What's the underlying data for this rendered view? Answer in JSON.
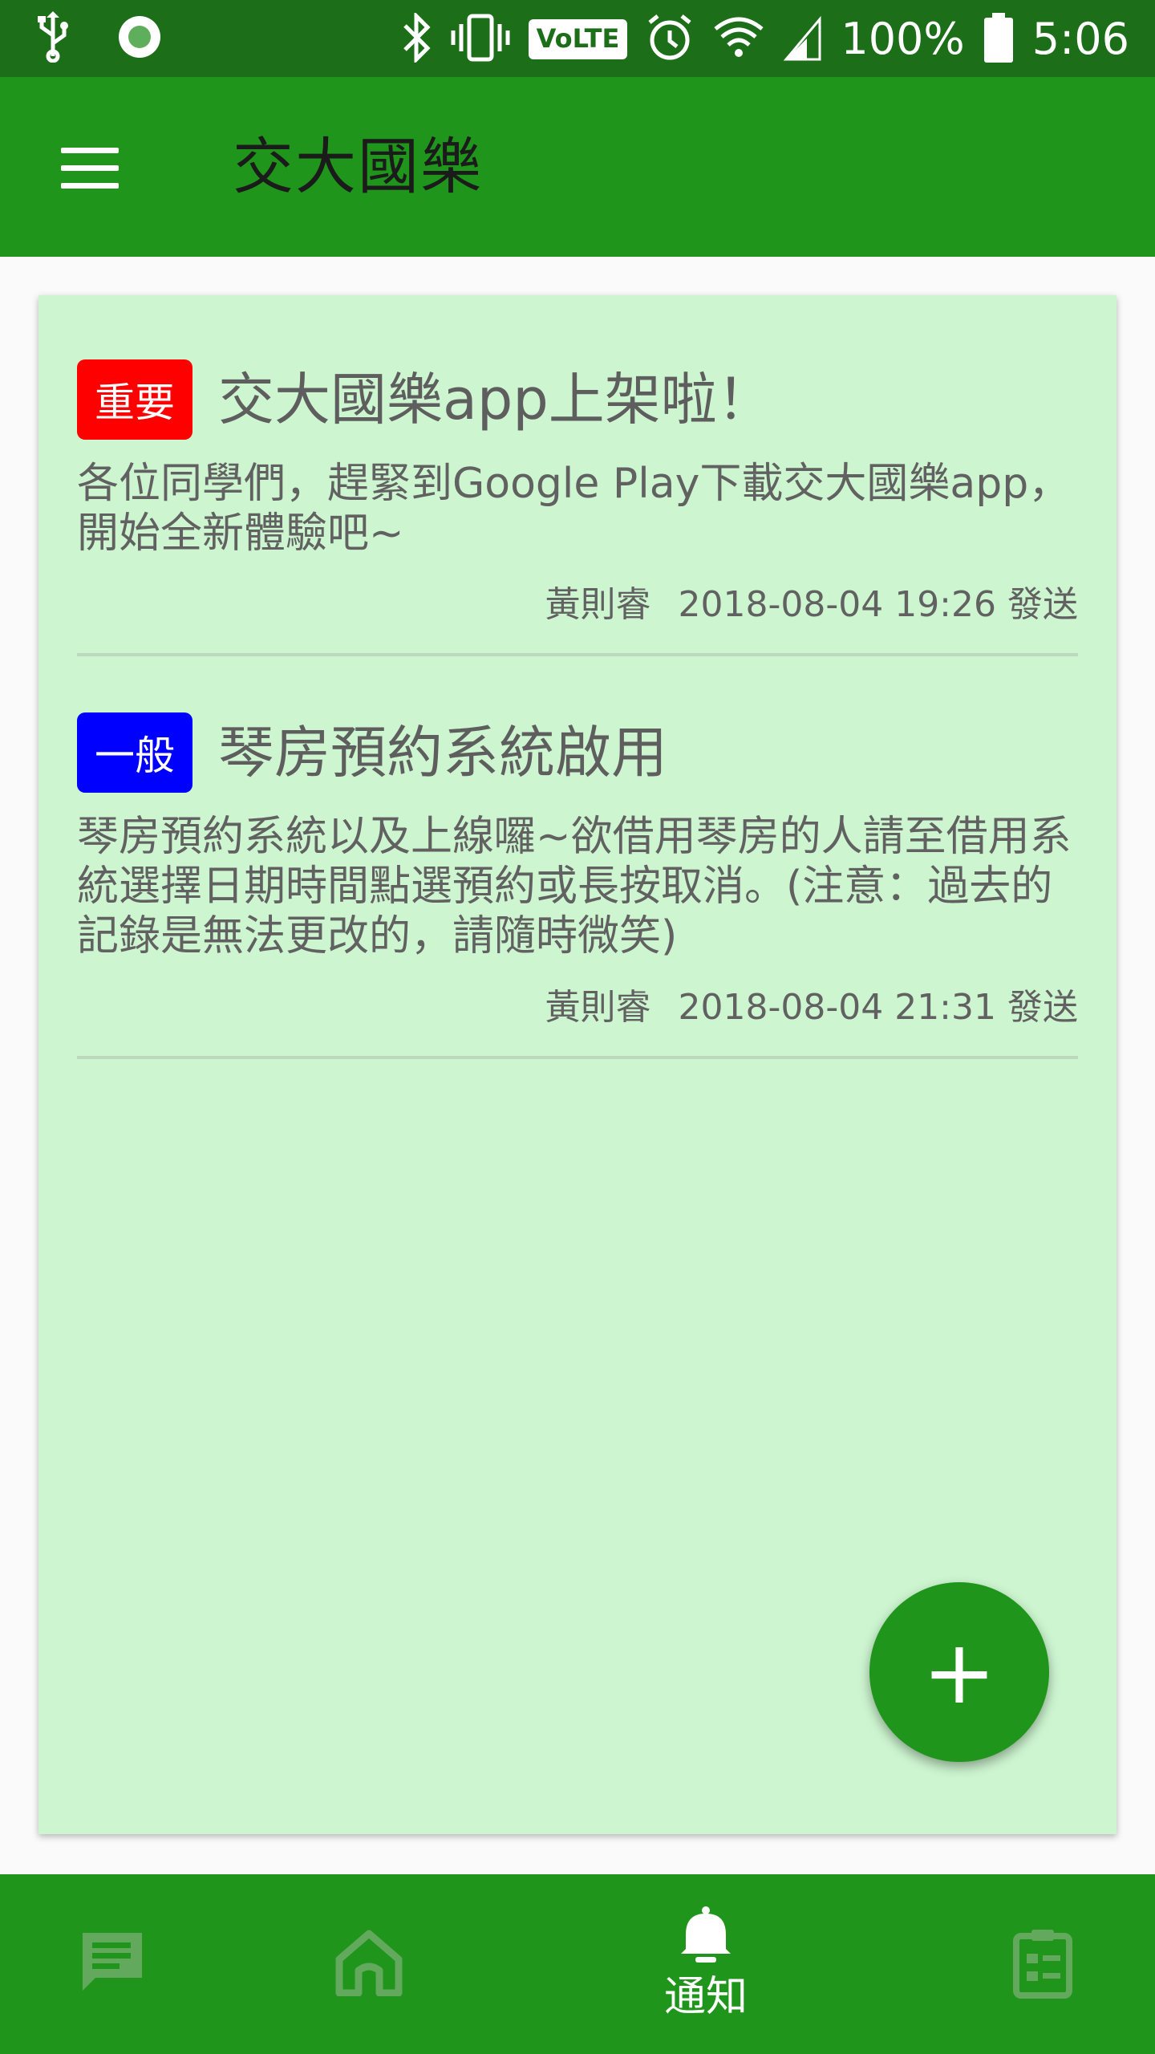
{
  "status_bar": {
    "volte": "VoLTE",
    "battery": "100%",
    "time": "5:06",
    "icons": [
      "usb-icon",
      "record-icon",
      "bluetooth-icon",
      "vibrate-icon",
      "alarm-icon",
      "wifi-icon",
      "signal-icon",
      "battery-icon"
    ]
  },
  "app_bar": {
    "title": "交大國樂",
    "menu_icon": "hamburger-menu-icon"
  },
  "notices": [
    {
      "badge": "重要",
      "badge_color": "#ff0000",
      "title": "交大國樂app上架啦！",
      "body": "各位同學們，趕緊到Google Play下載交大國樂app，開始全新體驗吧~",
      "sender": "黃則睿",
      "datetime": "2018-08-04 19:26",
      "sent_label": "發送"
    },
    {
      "badge": "一般",
      "badge_color": "#0000ff",
      "title": "琴房預約系統啟用",
      "body": "琴房預約系統以及上線囉~欲借用琴房的人請至借用系統選擇日期時間點選預約或長按取消。(注意：過去的記錄是無法更改的，請隨時微笑)",
      "sender": "黃則睿",
      "datetime": "2018-08-04 21:31",
      "sent_label": "發送"
    }
  ],
  "fab": {
    "label": "+",
    "icon": "add-icon"
  },
  "bottom_nav": {
    "items": [
      {
        "icon": "chat-icon",
        "label": "",
        "active": false
      },
      {
        "icon": "home-icon",
        "label": "",
        "active": false
      },
      {
        "icon": "bell-icon",
        "label": "通知",
        "active": true
      },
      {
        "icon": "clipboard-icon",
        "label": "",
        "active": false
      }
    ]
  },
  "colors": {
    "status_bar": "#1d6e18",
    "primary": "#1f961b",
    "card_background": "#cdf5d0",
    "nav_inactive_icon": "#62a85d"
  }
}
